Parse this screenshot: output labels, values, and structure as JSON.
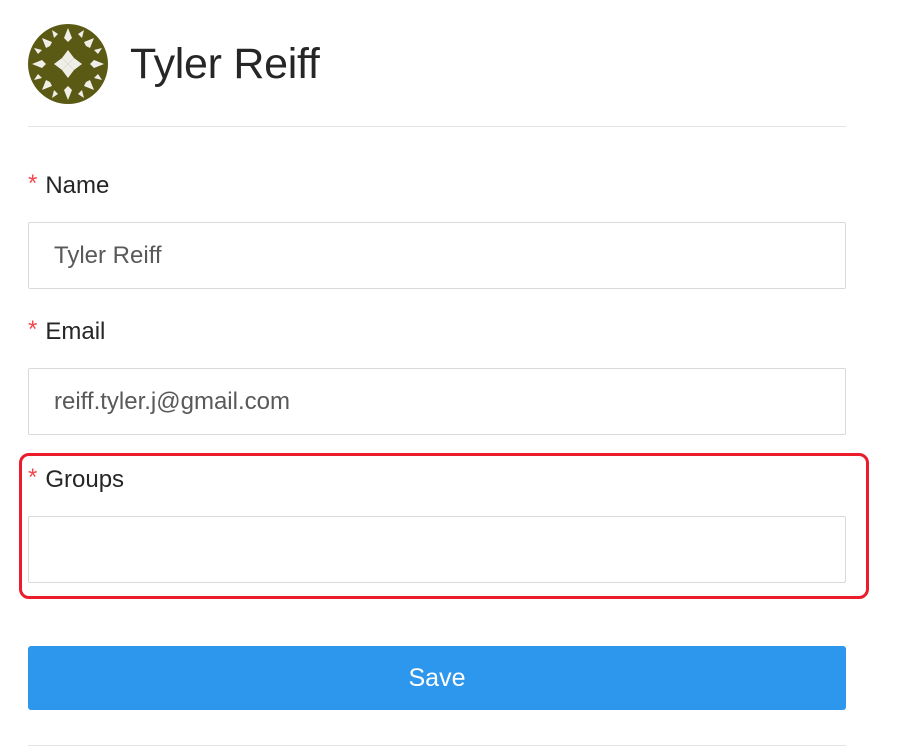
{
  "profile": {
    "name": "Tyler Reiff",
    "avatar_icon": "snowflake-pattern-avatar",
    "avatar_colors": {
      "background": "#5b5a14",
      "pattern": "#ffffff"
    }
  },
  "form": {
    "required_marker": "*",
    "name_field": {
      "label": "Name",
      "value": "Tyler Reiff"
    },
    "email_field": {
      "label": "Email",
      "value": "reiff.tyler.j@gmail.com"
    },
    "groups_field": {
      "label": "Groups",
      "value": ""
    },
    "save_label": "Save"
  },
  "colors": {
    "accent": "#2d97ed",
    "required": "#f5474c",
    "highlight": "#eb1c2b"
  }
}
